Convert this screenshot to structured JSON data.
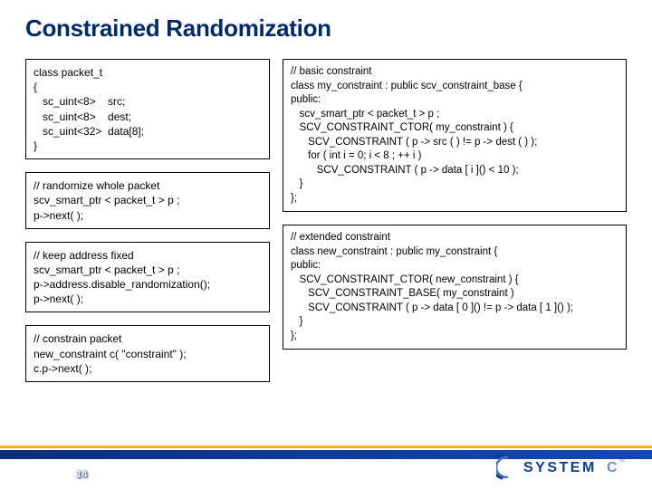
{
  "title": "Constrained Randomization",
  "page_number": "14",
  "logo_text": "SYSTEMC",
  "boxes": {
    "packet_class": "class packet_t\n{\n   sc_uint<8>    src;\n   sc_uint<8>    dest;\n   sc_uint<32>  data[8];\n}",
    "randomize": "// randomize whole packet\nscv_smart_ptr < packet_t > p ;\np->next( );",
    "keep_fixed": "// keep address fixed\nscv_smart_ptr < packet_t > p ;\np->address.disable_randomization();\np->next( );",
    "constrain": "// constrain packet\nnew_constraint c( \"constraint\" );\nc.p->next( );",
    "basic_constraint": "// basic constraint\nclass my_constraint : public scv_constraint_base {\npublic:\n   scv_smart_ptr < packet_t > p ;\n   SCV_CONSTRAINT_CTOR( my_constraint ) {\n      SCV_CONSTRAINT ( p -> src ( ) != p -> dest ( ) );\n      for ( int i = 0; i < 8 ; ++ i )\n         SCV_CONSTRAINT ( p -> data [ i ]() < 10 );\n   }\n};",
    "extended_constraint": "// extended constraint\nclass new_constraint : public my_constraint {\npublic:\n   SCV_CONSTRAINT_CTOR( new_constraint ) {\n      SCV_CONSTRAINT_BASE( my_constraint )\n      SCV_CONSTRAINT ( p -> data [ 0 ]() != p -> data [ 1 ]() );\n   }\n};"
  }
}
